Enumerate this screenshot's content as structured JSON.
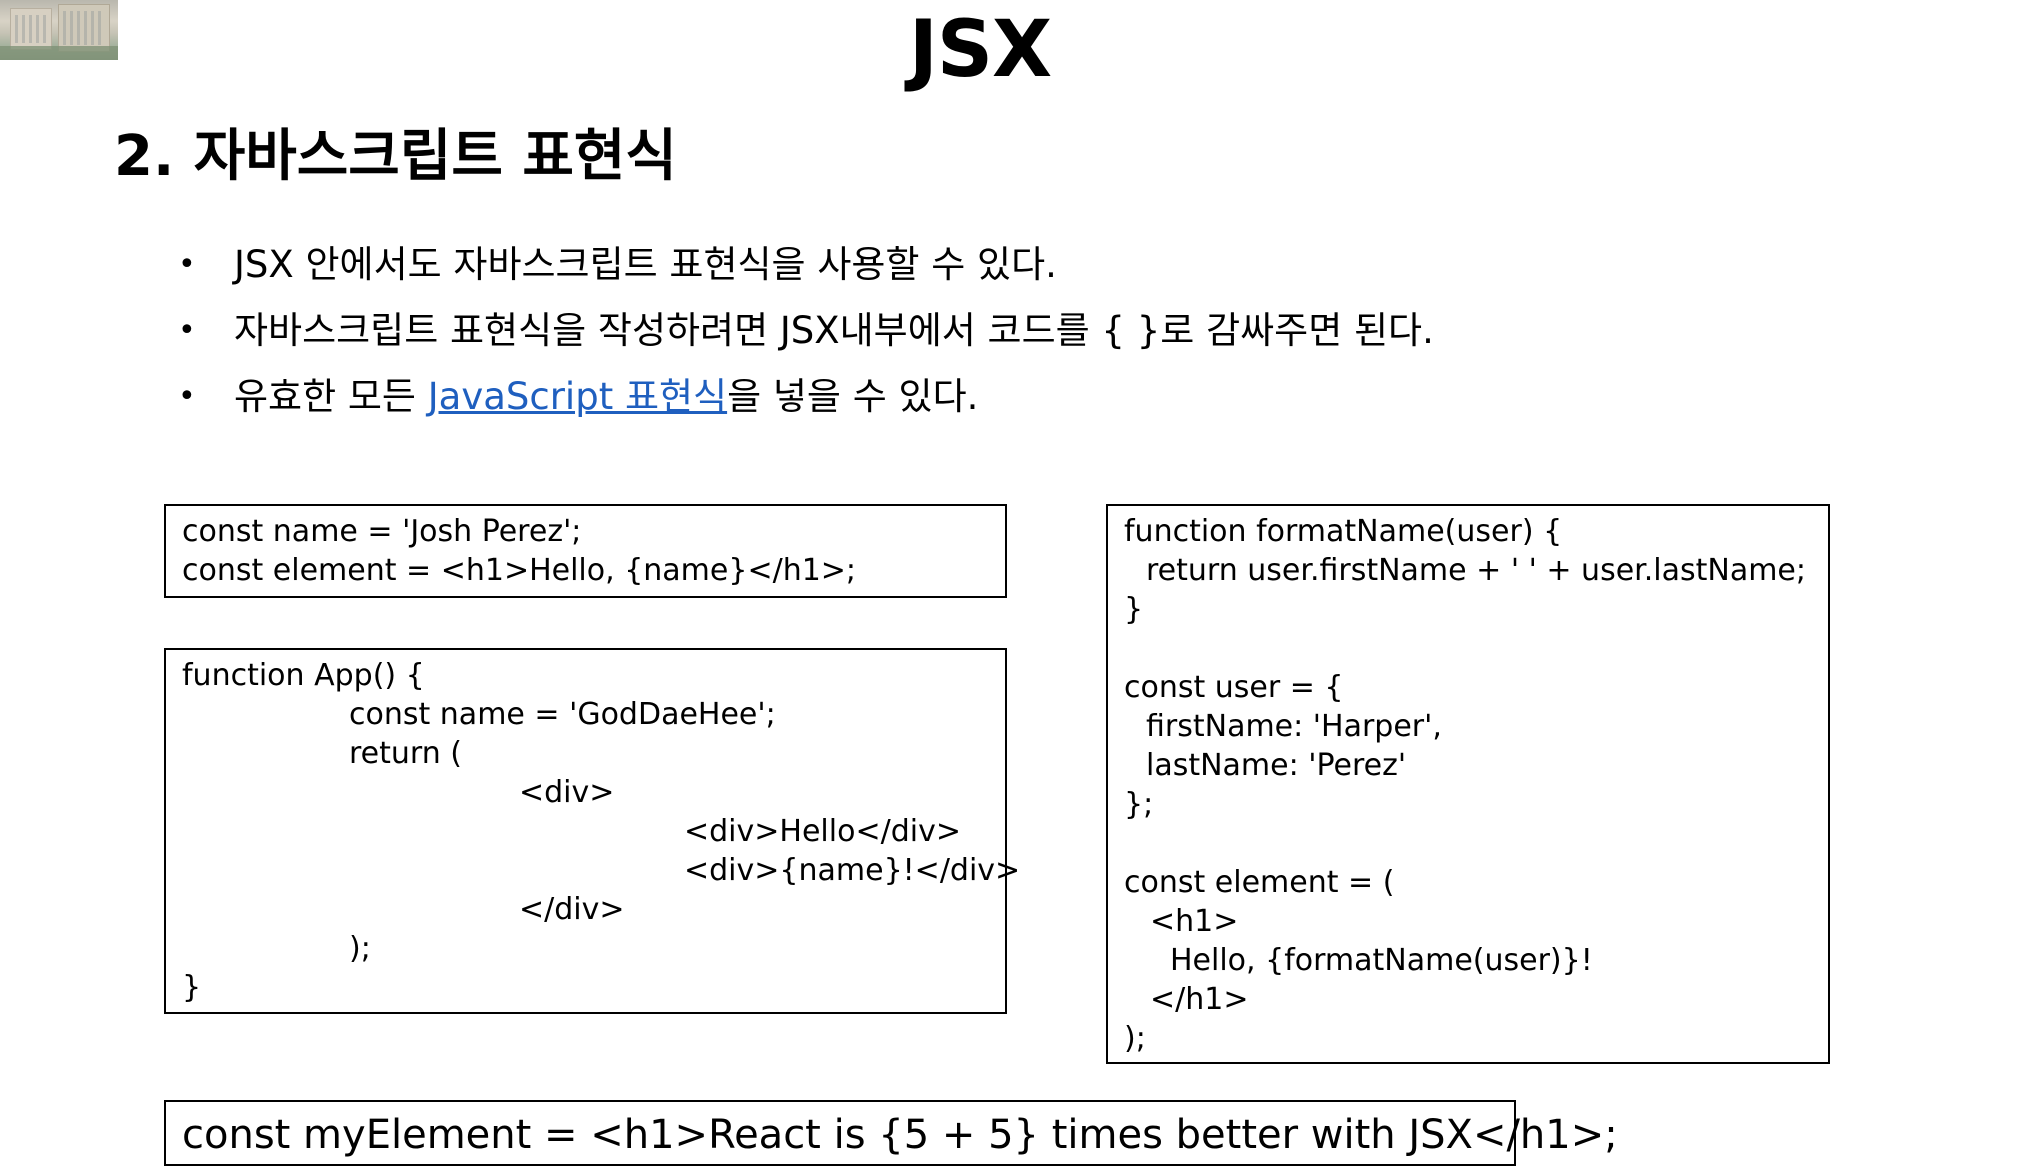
{
  "slide_title": "JSX",
  "section_heading": "2. 자바스크립트 표현식",
  "bullets": {
    "b1": "JSX 안에서도 자바스크립트 표현식을 사용할 수 있다.",
    "b2": "자바스크립트 표현식을 작성하려면 JSX내부에서 코드를 { }로 감싸주면 된다.",
    "b3_before": "유효한 모든 ",
    "b3_link": "JavaScript 표현식",
    "b3_after": "을 넣을 수 있다."
  },
  "bullet_glyph": "•",
  "code": {
    "box_a": [
      "const name = 'Josh Perez';",
      "const element = <h1>Hello, {name}</h1>;"
    ],
    "box_b": [
      "function App() {",
      "const name = 'GodDaeHee';",
      "return (",
      "<div>",
      "<div>Hello</div>",
      "<div>{name}!</div>",
      "</div>",
      ");",
      "}"
    ],
    "box_c": [
      "function formatName(user) {",
      "return user.firstName + ' ' + user.lastName;",
      "}",
      "",
      "const user = {",
      "firstName: 'Harper',",
      "lastName: 'Perez'",
      "};",
      "",
      "const element = (",
      "<h1>",
      "Hello, {formatName(user)}!",
      "</h1>",
      ");"
    ],
    "box_d": [
      "const myElement = <h1>React is {5 + 5} times better with JSX</h1>;"
    ]
  },
  "colors": {
    "link": "#1f5fbf",
    "text": "#000000",
    "border": "#000000"
  }
}
